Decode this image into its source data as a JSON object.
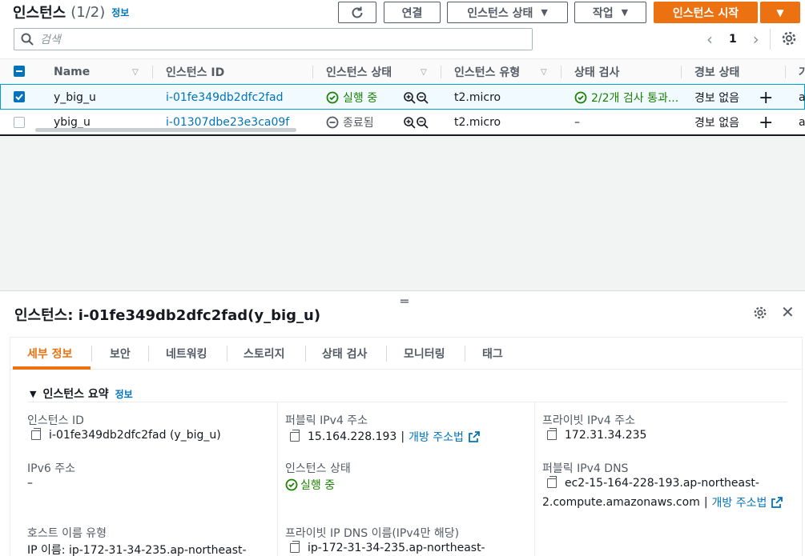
{
  "header": {
    "title": "인스턴스",
    "count": "(1/2)",
    "info": "정보",
    "buttons": {
      "connect": "연결",
      "instance_state": "인스턴스 상태",
      "actions": "작업",
      "launch": "인스턴스 시작"
    },
    "search_placeholder": "검색",
    "page": "1"
  },
  "table": {
    "columns": [
      "Name",
      "인스턴스 ID",
      "인스턴스 상태",
      "인스턴스 유형",
      "상태 검사",
      "경보 상태",
      "가"
    ],
    "rows": [
      {
        "selected": true,
        "name": "y_big_u",
        "id": "i-01fe349db2dfc2fad",
        "state": "실행 중",
        "type": "t2.micro",
        "check": "2/2개 검사 통과...",
        "alarm": "경보 없음",
        "extra": "a"
      },
      {
        "selected": false,
        "name": "ybig_u",
        "id": "i-01307dbe23e3ca09f",
        "state": "종료됨",
        "type": "t2.micro",
        "check": "–",
        "alarm": "경보 없음",
        "extra": "a"
      }
    ]
  },
  "detail": {
    "title_label": "인스턴스:",
    "title_value": "i-01fe349db2dfc2fad(y_big_u)",
    "tabs": [
      "세부 정보",
      "보안",
      "네트워킹",
      "스토리지",
      "상태 검사",
      "모니터링",
      "태그"
    ],
    "summary_title": "인스턴스 요약",
    "summary_info": "정보",
    "fields": {
      "instance_id_label": "인스턴스 ID",
      "instance_id_value": "i-01fe349db2dfc2fad (y_big_u)",
      "public_ipv4_label": "퍼블릭 IPv4 주소",
      "public_ipv4_value": "15.164.228.193",
      "public_ipv4_sep": "|",
      "open_address": "개방 주소법",
      "private_ipv4_label": "프라이빗 IPv4 주소",
      "private_ipv4_value": "172.31.34.235",
      "ipv6_label": "IPv6 주소",
      "ipv6_value": "–",
      "state_label": "인스턴스 상태",
      "state_value": "실행 중",
      "public_dns_label": "퍼블릭 IPv4 DNS",
      "public_dns_line1": "ec2-15-164-228-193.ap-northeast-",
      "public_dns_line2": "2.compute.amazonaws.com",
      "public_dns_sep": "|",
      "host_type_label": "호스트 이름 유형",
      "host_type_value": "IP 이름: ip-172-31-34-235.ap-northeast-",
      "private_dns_label": "프라이빗 IP DNS 이름(IPv4만 해당)",
      "private_dns_value": "ip-172-31-34-235.ap-northeast-"
    }
  },
  "colors": {
    "accent_orange": "#ec7211",
    "link_blue": "#0073bb",
    "success_green": "#1d8102"
  }
}
